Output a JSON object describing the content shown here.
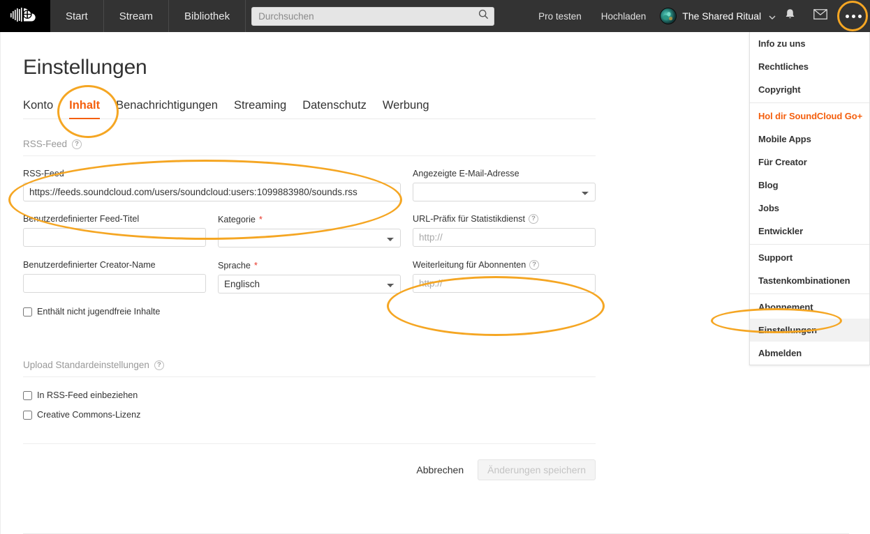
{
  "topbar": {
    "logo_icon": "soundcloud-logo-icon",
    "nav": [
      {
        "label": "Start"
      },
      {
        "label": "Stream"
      },
      {
        "label": "Bibliothek"
      }
    ],
    "search": {
      "placeholder": "Durchsuchen",
      "value": "",
      "icon": "search-icon"
    },
    "pro_label": "Pro testen",
    "upload_label": "Hochladen",
    "username": "The Shared Ritual",
    "caret_icon": "chevron-down-icon",
    "notifications_icon": "bell-icon",
    "messages_icon": "envelope-icon",
    "more_icon": "ellipsis-icon"
  },
  "dropdown": {
    "groups": [
      {
        "items": [
          {
            "label": "Info zu uns",
            "style": "normal"
          },
          {
            "label": "Rechtliches",
            "style": "normal"
          },
          {
            "label": "Copyright",
            "style": "normal"
          }
        ]
      },
      {
        "items": [
          {
            "label": "Hol dir SoundCloud Go+",
            "style": "promo"
          },
          {
            "label": "Mobile Apps",
            "style": "normal"
          },
          {
            "label": "Für Creator",
            "style": "normal"
          },
          {
            "label": "Blog",
            "style": "normal"
          },
          {
            "label": "Jobs",
            "style": "normal"
          },
          {
            "label": "Entwickler",
            "style": "normal"
          }
        ]
      },
      {
        "items": [
          {
            "label": "Support",
            "style": "normal"
          },
          {
            "label": "Tastenkombinationen",
            "style": "normal"
          }
        ]
      },
      {
        "items": [
          {
            "label": "Abonnement",
            "style": "normal"
          },
          {
            "label": "Einstellungen",
            "style": "active"
          },
          {
            "label": "Abmelden",
            "style": "normal"
          }
        ]
      }
    ]
  },
  "page": {
    "title": "Einstellungen",
    "tabs": [
      {
        "label": "Konto",
        "selected": false
      },
      {
        "label": "Inhalt",
        "selected": true
      },
      {
        "label": "Benachrichtigungen",
        "selected": false
      },
      {
        "label": "Streaming",
        "selected": false
      },
      {
        "label": "Datenschutz",
        "selected": false
      },
      {
        "label": "Werbung",
        "selected": false
      }
    ],
    "sections": {
      "rss": {
        "header": "RSS-Feed",
        "fields": {
          "rss_feed": {
            "label": "RSS-Feed",
            "value": "https://feeds.soundcloud.com/users/soundcloud:users:1099883980/sounds.rss",
            "placeholder": ""
          },
          "display_email": {
            "label": "Angezeigte E-Mail-Adresse",
            "value": "",
            "options": [
              ""
            ]
          },
          "feed_title": {
            "label": "Benutzerdefinierter Feed-Titel",
            "value": "",
            "placeholder": ""
          },
          "category": {
            "label": "Kategorie",
            "required": "*",
            "value": "",
            "options": [
              ""
            ]
          },
          "stats_prefix": {
            "label": "URL-Präfix für Statistikdienst",
            "value": "",
            "placeholder": "http://"
          },
          "creator_name": {
            "label": "Benutzerdefinierter Creator-Name",
            "value": "",
            "placeholder": ""
          },
          "language": {
            "label": "Sprache",
            "required": "*",
            "value": "Englisch",
            "options": [
              "Englisch"
            ]
          },
          "subscriber_redirect": {
            "label": "Weiterleitung für Abonnenten",
            "value": "",
            "placeholder": "http://"
          }
        },
        "explicit_checkbox": {
          "label": "Enthält nicht jugendfreie Inhalte",
          "checked": false
        }
      },
      "upload_defaults": {
        "header": "Upload Standardeinstellungen",
        "checkboxes": [
          {
            "label": "In RSS-Feed einbeziehen",
            "checked": false
          },
          {
            "label": "Creative Commons-Lizenz",
            "checked": false
          }
        ]
      }
    },
    "actions": {
      "cancel": "Abbrechen",
      "save": "Änderungen speichern"
    }
  },
  "colors": {
    "brand_orange": "#f45f0e",
    "highlight_ring": "#f5a623",
    "topbar_bg": "#333333",
    "required_red": "#e8372a"
  }
}
